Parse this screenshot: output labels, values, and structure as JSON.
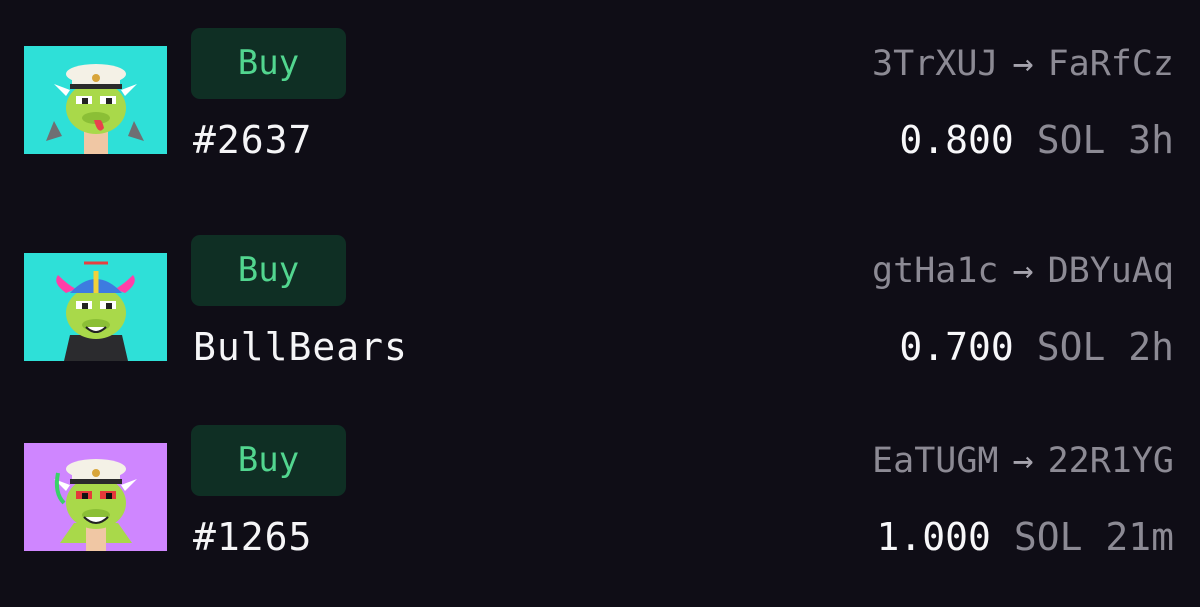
{
  "sales": [
    {
      "buy_label": "Buy",
      "name": "#2637",
      "from": "3TrXUJ",
      "to": "FaRfCz",
      "arrow": "→",
      "price": "0.800",
      "currency": "SOL",
      "age": "3h",
      "thumb_bg": "#2ee0d8"
    },
    {
      "buy_label": "Buy",
      "name": "BullBears",
      "from": "gtHa1c",
      "to": "DBYuAq",
      "arrow": "→",
      "price": "0.700",
      "currency": "SOL",
      "age": "2h",
      "thumb_bg": "#2ee0d8"
    },
    {
      "buy_label": "Buy",
      "name": "#1265",
      "from": "EaTUGM",
      "to": "22R1YG",
      "arrow": "→",
      "price": "1.000",
      "currency": "SOL",
      "age": "21m",
      "thumb_bg": "#cf86ff"
    }
  ],
  "colors": {
    "background": "#0f0d16",
    "buy_bg": "#0f2f24",
    "buy_text": "#52d68f",
    "muted": "#8c8a94"
  }
}
